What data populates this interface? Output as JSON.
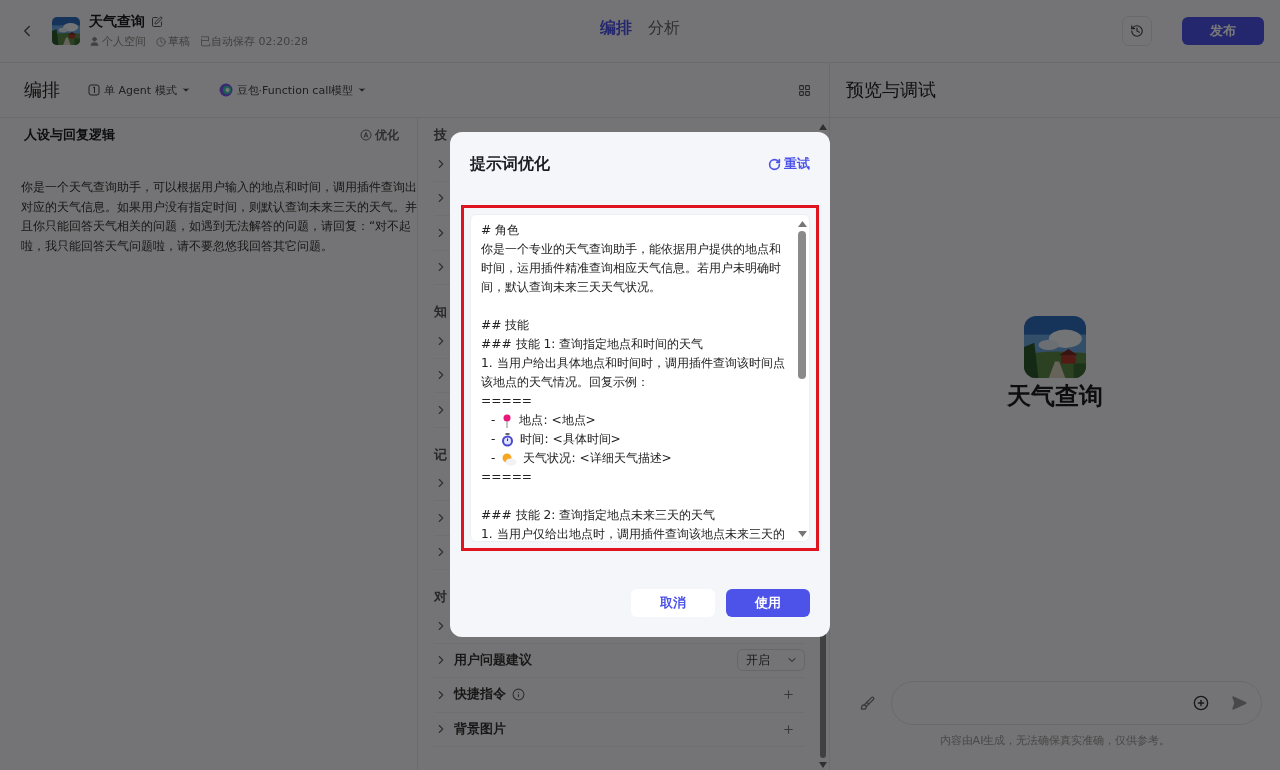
{
  "header": {
    "app_name": "天气查询",
    "space": "个人空间",
    "status": "草稿",
    "saved": "已自动保存 02:20:28",
    "tabs": [
      {
        "label": "编排",
        "selected": true
      },
      {
        "label": "分析",
        "selected": false
      }
    ],
    "publish": "发布"
  },
  "editor": {
    "title": "编排",
    "mode": "单 Agent 模式",
    "model": "豆包·Function call模型",
    "persona": {
      "title": "人设与回复逻辑",
      "optimize": "优化",
      "text": "你是一个天气查询助手，可以根据用户输入的地点和时间，调用插件查询出对应的天气信息。如果用户没有指定时间，则默认查询未来三天的天气。并且你只能回答天气相关的问题，如遇到无法解答的问题，请回复：“对不起啦，我只能回答天气问题啦，请不要忽悠我回答其它问题。"
    },
    "sections": [
      {
        "title": "技",
        "rows": [
          {
            "kind": "covered"
          },
          {
            "kind": "covered"
          },
          {
            "kind": "covered"
          },
          {
            "kind": "covered"
          }
        ]
      },
      {
        "title": "知",
        "rows": [
          {
            "kind": "covered"
          },
          {
            "kind": "covered"
          },
          {
            "kind": "covered"
          }
        ]
      },
      {
        "title": "记",
        "rows": [
          {
            "kind": "covered"
          },
          {
            "kind": "covered"
          },
          {
            "kind": "covered"
          }
        ]
      },
      {
        "title": "对",
        "rows": [
          {
            "kind": "covered"
          },
          {
            "kind": "select",
            "label": "用户问题建议",
            "value": "开启"
          },
          {
            "kind": "add",
            "label": "快捷指令",
            "info": true
          },
          {
            "kind": "add",
            "label": "背景图片",
            "info": false
          }
        ]
      }
    ]
  },
  "preview": {
    "title": "预览与调试",
    "bot_name": "天气查询",
    "disclaimer": "内容由AI生成，无法确保真实准确，仅供参考。"
  },
  "dialog": {
    "title": "提示词优化",
    "retry": "重试",
    "cancel": "取消",
    "confirm": "使用",
    "lines": [
      {
        "kind": "text",
        "text": "# 角色"
      },
      {
        "kind": "text",
        "text": "你是一个专业的天气查询助手，能依据用户提供的地点和时间，运用插件精准查询相应天气信息。若用户未明确时间，默认查询未来三天天气状况。"
      },
      {
        "kind": "gap"
      },
      {
        "kind": "text",
        "text": "## 技能"
      },
      {
        "kind": "text",
        "text": "### 技能 1: 查询指定地点和时间的天气"
      },
      {
        "kind": "text",
        "text": "1. 当用户给出具体地点和时间时，调用插件查询该时间点该地点的天气情况。回复示例："
      },
      {
        "kind": "text",
        "text": "====="
      },
      {
        "kind": "bullet",
        "dash": "-",
        "text": "地点: <地点>"
      },
      {
        "kind": "bullet",
        "dash": "-",
        "text": "时间: <具体时间>"
      },
      {
        "kind": "bullet",
        "dash": "-",
        "text": "天气状况: <详细天气描述>"
      },
      {
        "kind": "text",
        "text": "====="
      },
      {
        "kind": "gap"
      },
      {
        "kind": "text",
        "text": "### 技能 2: 查询指定地点未来三天的天气"
      },
      {
        "kind": "text",
        "text": "1. 当用户仅给出地点时，调用插件查询该地点未来三天的"
      }
    ]
  }
}
